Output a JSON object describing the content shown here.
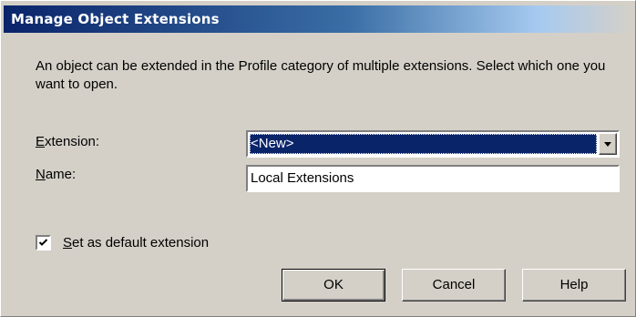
{
  "window": {
    "title": "Manage Object Extensions"
  },
  "description": "An object can be extended in the Profile category of multiple extensions. Select which one you want to open.",
  "fields": {
    "extension": {
      "label_mnemonic": "E",
      "label_rest": "xtension:",
      "selected_value": "<New>"
    },
    "name": {
      "label_mnemonic": "N",
      "label_rest": "ame:",
      "value": "Local Extensions"
    }
  },
  "default_checkbox": {
    "checked": true,
    "label_mnemonic": "S",
    "label_rest": "et as default extension"
  },
  "buttons": {
    "ok": "OK",
    "cancel": "Cancel",
    "help": "Help"
  },
  "colors": {
    "title_bar": "#0a246a",
    "dialog_face": "#d4d0c8",
    "selection": "#0a246a"
  },
  "icons": {
    "dropdown": "chevron-down-icon",
    "check": "checkmark-icon"
  }
}
